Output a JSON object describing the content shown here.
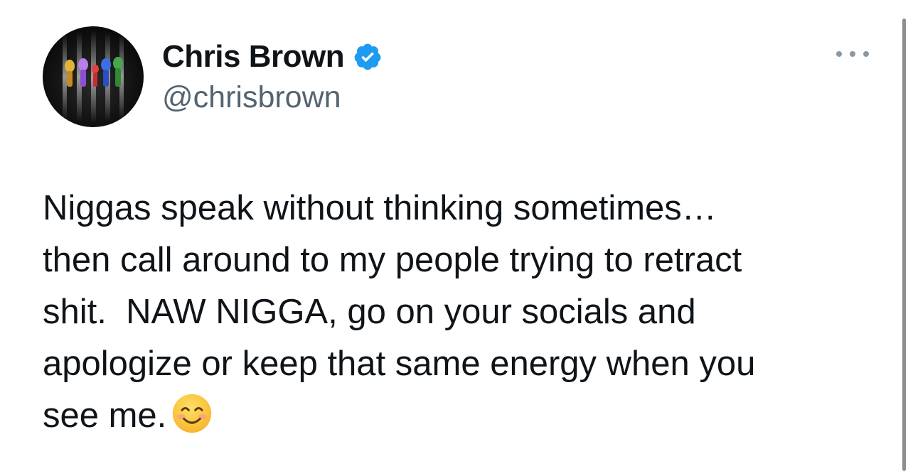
{
  "author": {
    "display_name": "Chris Brown",
    "handle": "@chrisbrown",
    "verified": true,
    "avatar_icon": "avatar-image"
  },
  "tweet": {
    "lines": [
      "Niggas speak without thinking sometimes…",
      "then call around to my people trying to retract",
      "shit.  NAW NIGGA, go on your socials and",
      "apologize or keep that same energy when you",
      "see me."
    ],
    "emoji": "smiling-face-emoji"
  },
  "menu": {
    "icon": "more-options-icon"
  },
  "colors": {
    "text_primary": "#0f1419",
    "text_secondary": "#536471",
    "verified_blue": "#1d9bf0",
    "more_dots": "#8b98a5"
  }
}
